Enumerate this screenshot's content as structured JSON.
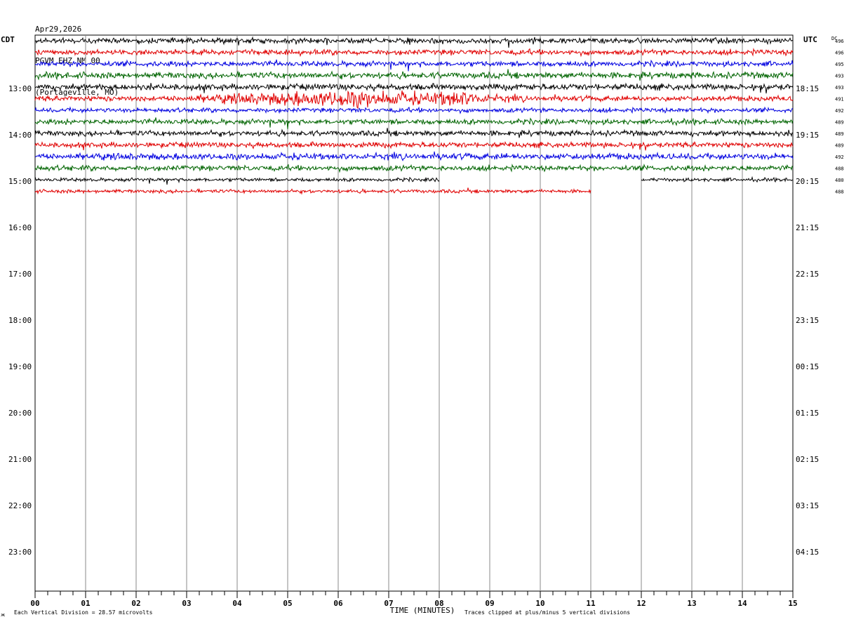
{
  "header": {
    "date": "Apr29,2026",
    "station": "PGVM EHZ NM 00",
    "location": "(Portageville, MO)"
  },
  "left_zone_label": "CDT",
  "right_zone_label": "UTC",
  "dc_label": "DC",
  "footer": {
    "scale": "Each Vertical Division =   28.57 microvolts",
    "clip": "Traces clipped at plus/minus 5 vertical divisions",
    "corner_mark": "ж"
  },
  "chart_data": {
    "type": "line",
    "title": "",
    "xlabel": "TIME (MINUTES)",
    "x_ticks": [
      "00",
      "01",
      "02",
      "03",
      "04",
      "05",
      "06",
      "07",
      "08",
      "09",
      "10",
      "11",
      "12",
      "13",
      "14",
      "15"
    ],
    "xlim": [
      0,
      15
    ],
    "left_hour_labels": [
      "13:00",
      "14:00",
      "15:00",
      "16:00",
      "17:00",
      "18:00",
      "19:00",
      "20:00",
      "21:00",
      "22:00",
      "23:00"
    ],
    "right_hour_labels": [
      "18:15",
      "19:15",
      "20:15",
      "21:15",
      "22:15",
      "23:15",
      "00:15",
      "01:15",
      "02:15",
      "03:15",
      "04:15"
    ],
    "trace_colors": [
      "#000000",
      "#e00000",
      "#0000e0",
      "#006400"
    ],
    "traces": [
      {
        "dc": "496",
        "color": "#000000",
        "start_min": 0,
        "end_min": 15,
        "amplitude": 3.0
      },
      {
        "dc": "496",
        "color": "#e00000",
        "start_min": 0,
        "end_min": 15,
        "amplitude": 3.0
      },
      {
        "dc": "495",
        "color": "#0000e0",
        "start_min": 0,
        "end_min": 15,
        "amplitude": 3.0
      },
      {
        "dc": "493",
        "color": "#006400",
        "start_min": 0,
        "end_min": 15,
        "amplitude": 3.5
      },
      {
        "dc": "493",
        "color": "#000000",
        "start_min": 0,
        "end_min": 15,
        "amplitude": 3.5
      },
      {
        "dc": "491",
        "color": "#e00000",
        "start_min": 0,
        "end_min": 15,
        "amplitude": 3.0,
        "event": {
          "start_min": 2.5,
          "end_min": 10.0,
          "peak_min": 6.2,
          "peak_amplitude": 10
        }
      },
      {
        "dc": "492",
        "color": "#0000e0",
        "start_min": 0,
        "end_min": 15,
        "amplitude": 2.5
      },
      {
        "dc": "489",
        "color": "#006400",
        "start_min": 0,
        "end_min": 15,
        "amplitude": 3.0
      },
      {
        "dc": "489",
        "color": "#000000",
        "start_min": 0,
        "end_min": 15,
        "amplitude": 3.0
      },
      {
        "dc": "489",
        "color": "#e00000",
        "start_min": 0,
        "end_min": 15,
        "amplitude": 3.0
      },
      {
        "dc": "492",
        "color": "#0000e0",
        "start_min": 0,
        "end_min": 15,
        "amplitude": 3.5
      },
      {
        "dc": "488",
        "color": "#006400",
        "start_min": 0,
        "end_min": 15,
        "amplitude": 3.0
      },
      {
        "dc": "480",
        "color": "#000000",
        "segments": [
          [
            0,
            8.0
          ],
          [
            12.0,
            15
          ]
        ],
        "amplitude": 2.0
      },
      {
        "dc": "488",
        "color": "#e00000",
        "start_min": 0,
        "end_min": 11.0,
        "amplitude": 2.0
      }
    ]
  }
}
